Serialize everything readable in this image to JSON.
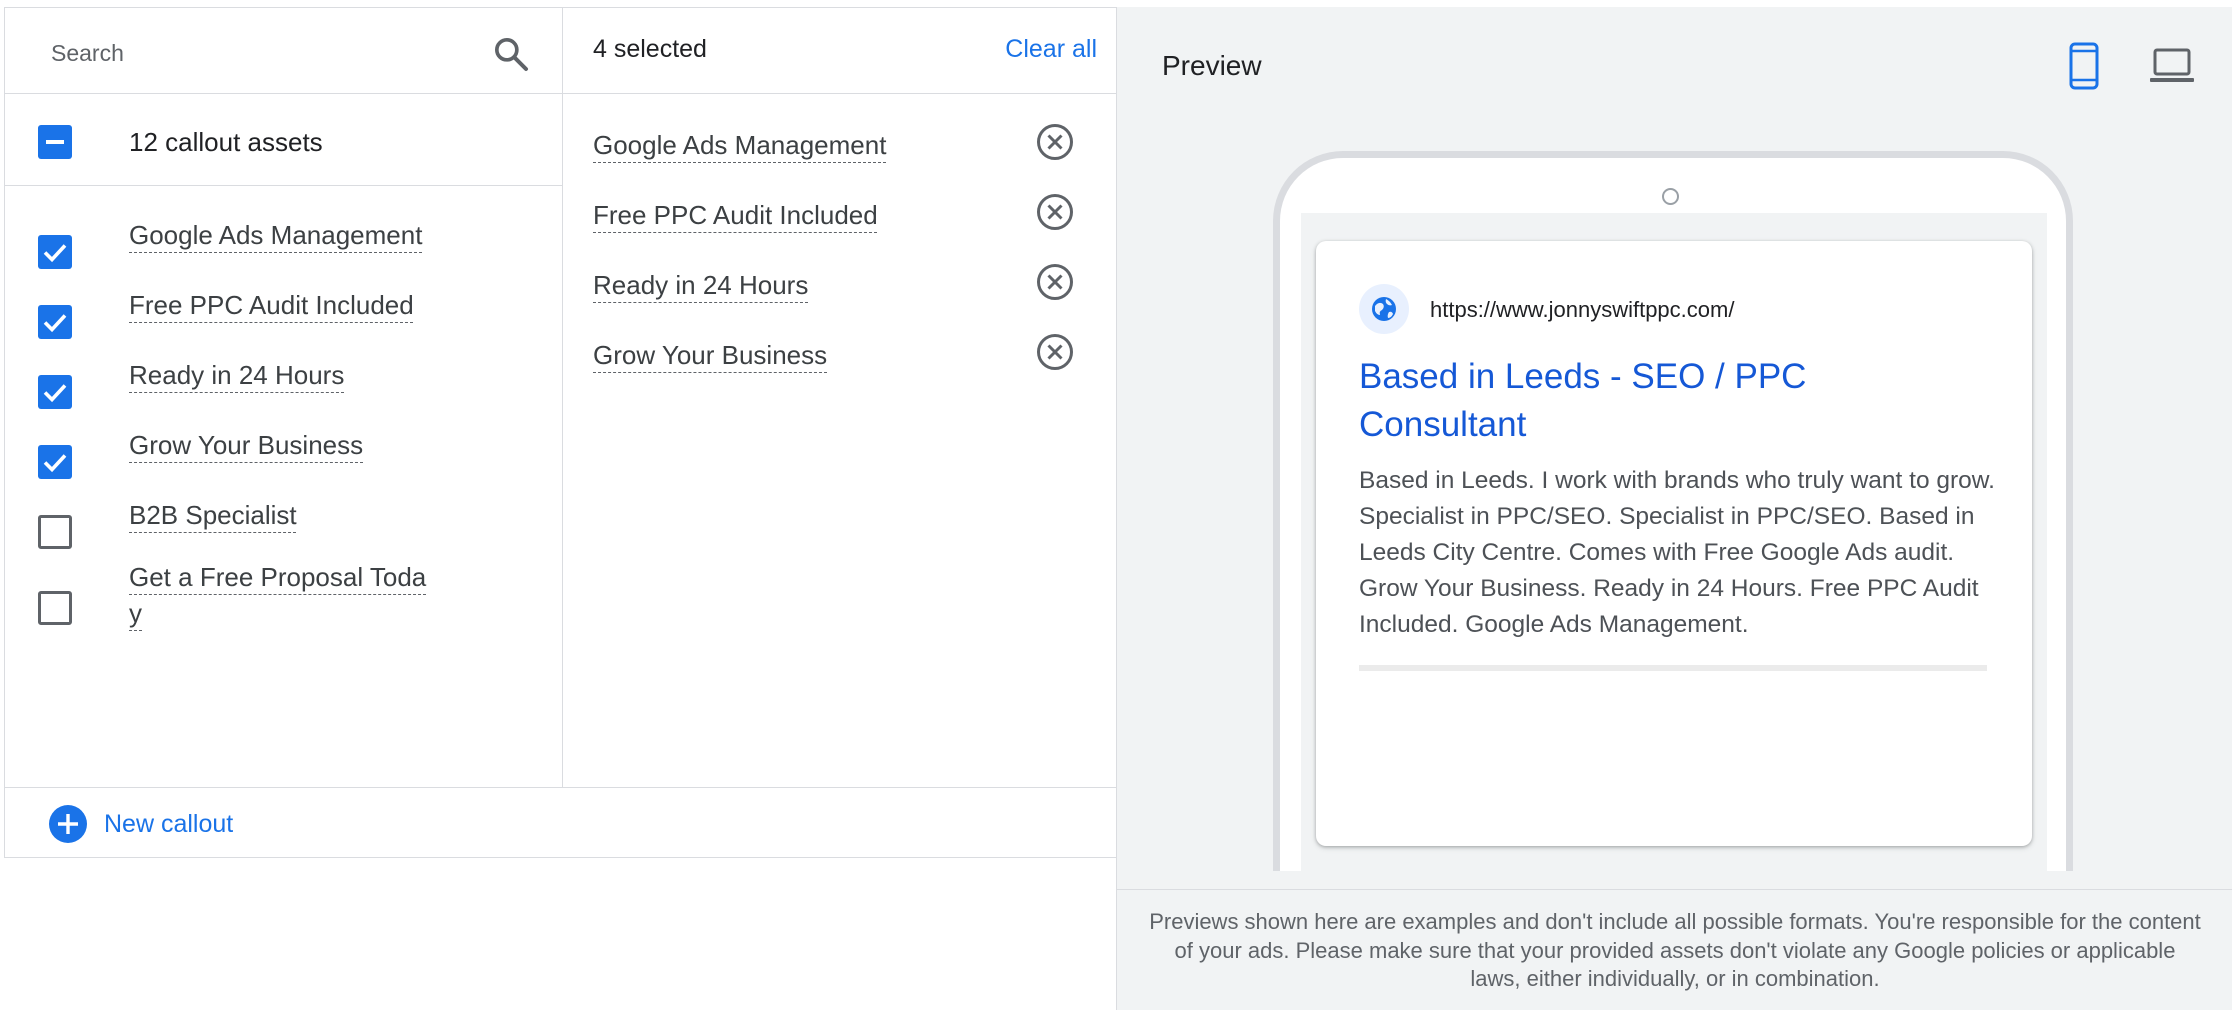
{
  "search": {
    "placeholder": "Search"
  },
  "callout_list": {
    "header_label": "12 callout assets",
    "header_state": "indeterminate",
    "items": [
      {
        "label": "Google Ads Management",
        "checked": true
      },
      {
        "label": "Free PPC Audit Included",
        "checked": true
      },
      {
        "label": "Ready in 24 Hours",
        "checked": true
      },
      {
        "label": "Grow Your Business",
        "checked": true
      },
      {
        "label": "B2B Specialist",
        "checked": false
      },
      {
        "label": "Get a Free Proposal Toda y",
        "checked": false
      }
    ]
  },
  "selected": {
    "count_label": "4 selected",
    "clear_label": "Clear all",
    "items": [
      {
        "label": "Google Ads Management"
      },
      {
        "label": "Free PPC Audit Included"
      },
      {
        "label": "Ready in 24 Hours"
      },
      {
        "label": "Grow Your Business"
      }
    ]
  },
  "footer": {
    "new_callout_label": "New callout"
  },
  "preview": {
    "title": "Preview",
    "active_device": "mobile",
    "ad": {
      "url": "https://www.jonnyswiftppc.com/",
      "headline": "Based in Leeds - SEO / PPC Consultant",
      "description": "Based in Leeds. I work with brands who truly want to grow. Specialist in PPC/SEO. Specialist in PPC/SEO. Based in Leeds City Centre. Comes with Free Google Ads audit. Grow Your Business. Ready in 24 Hours. Free PPC Audit Included. Google Ads Management."
    },
    "disclaimer": "Previews shown here are examples and don't include all possible formats. You're responsible for the content of your ads. Please make sure that your provided assets don't violate any Google policies or applicable laws, either individually, or in combination."
  },
  "colors": {
    "accent": "#1a73e8",
    "headline_link": "#1558d6",
    "border": "#dadce0",
    "preview_bg": "#f1f3f4"
  }
}
